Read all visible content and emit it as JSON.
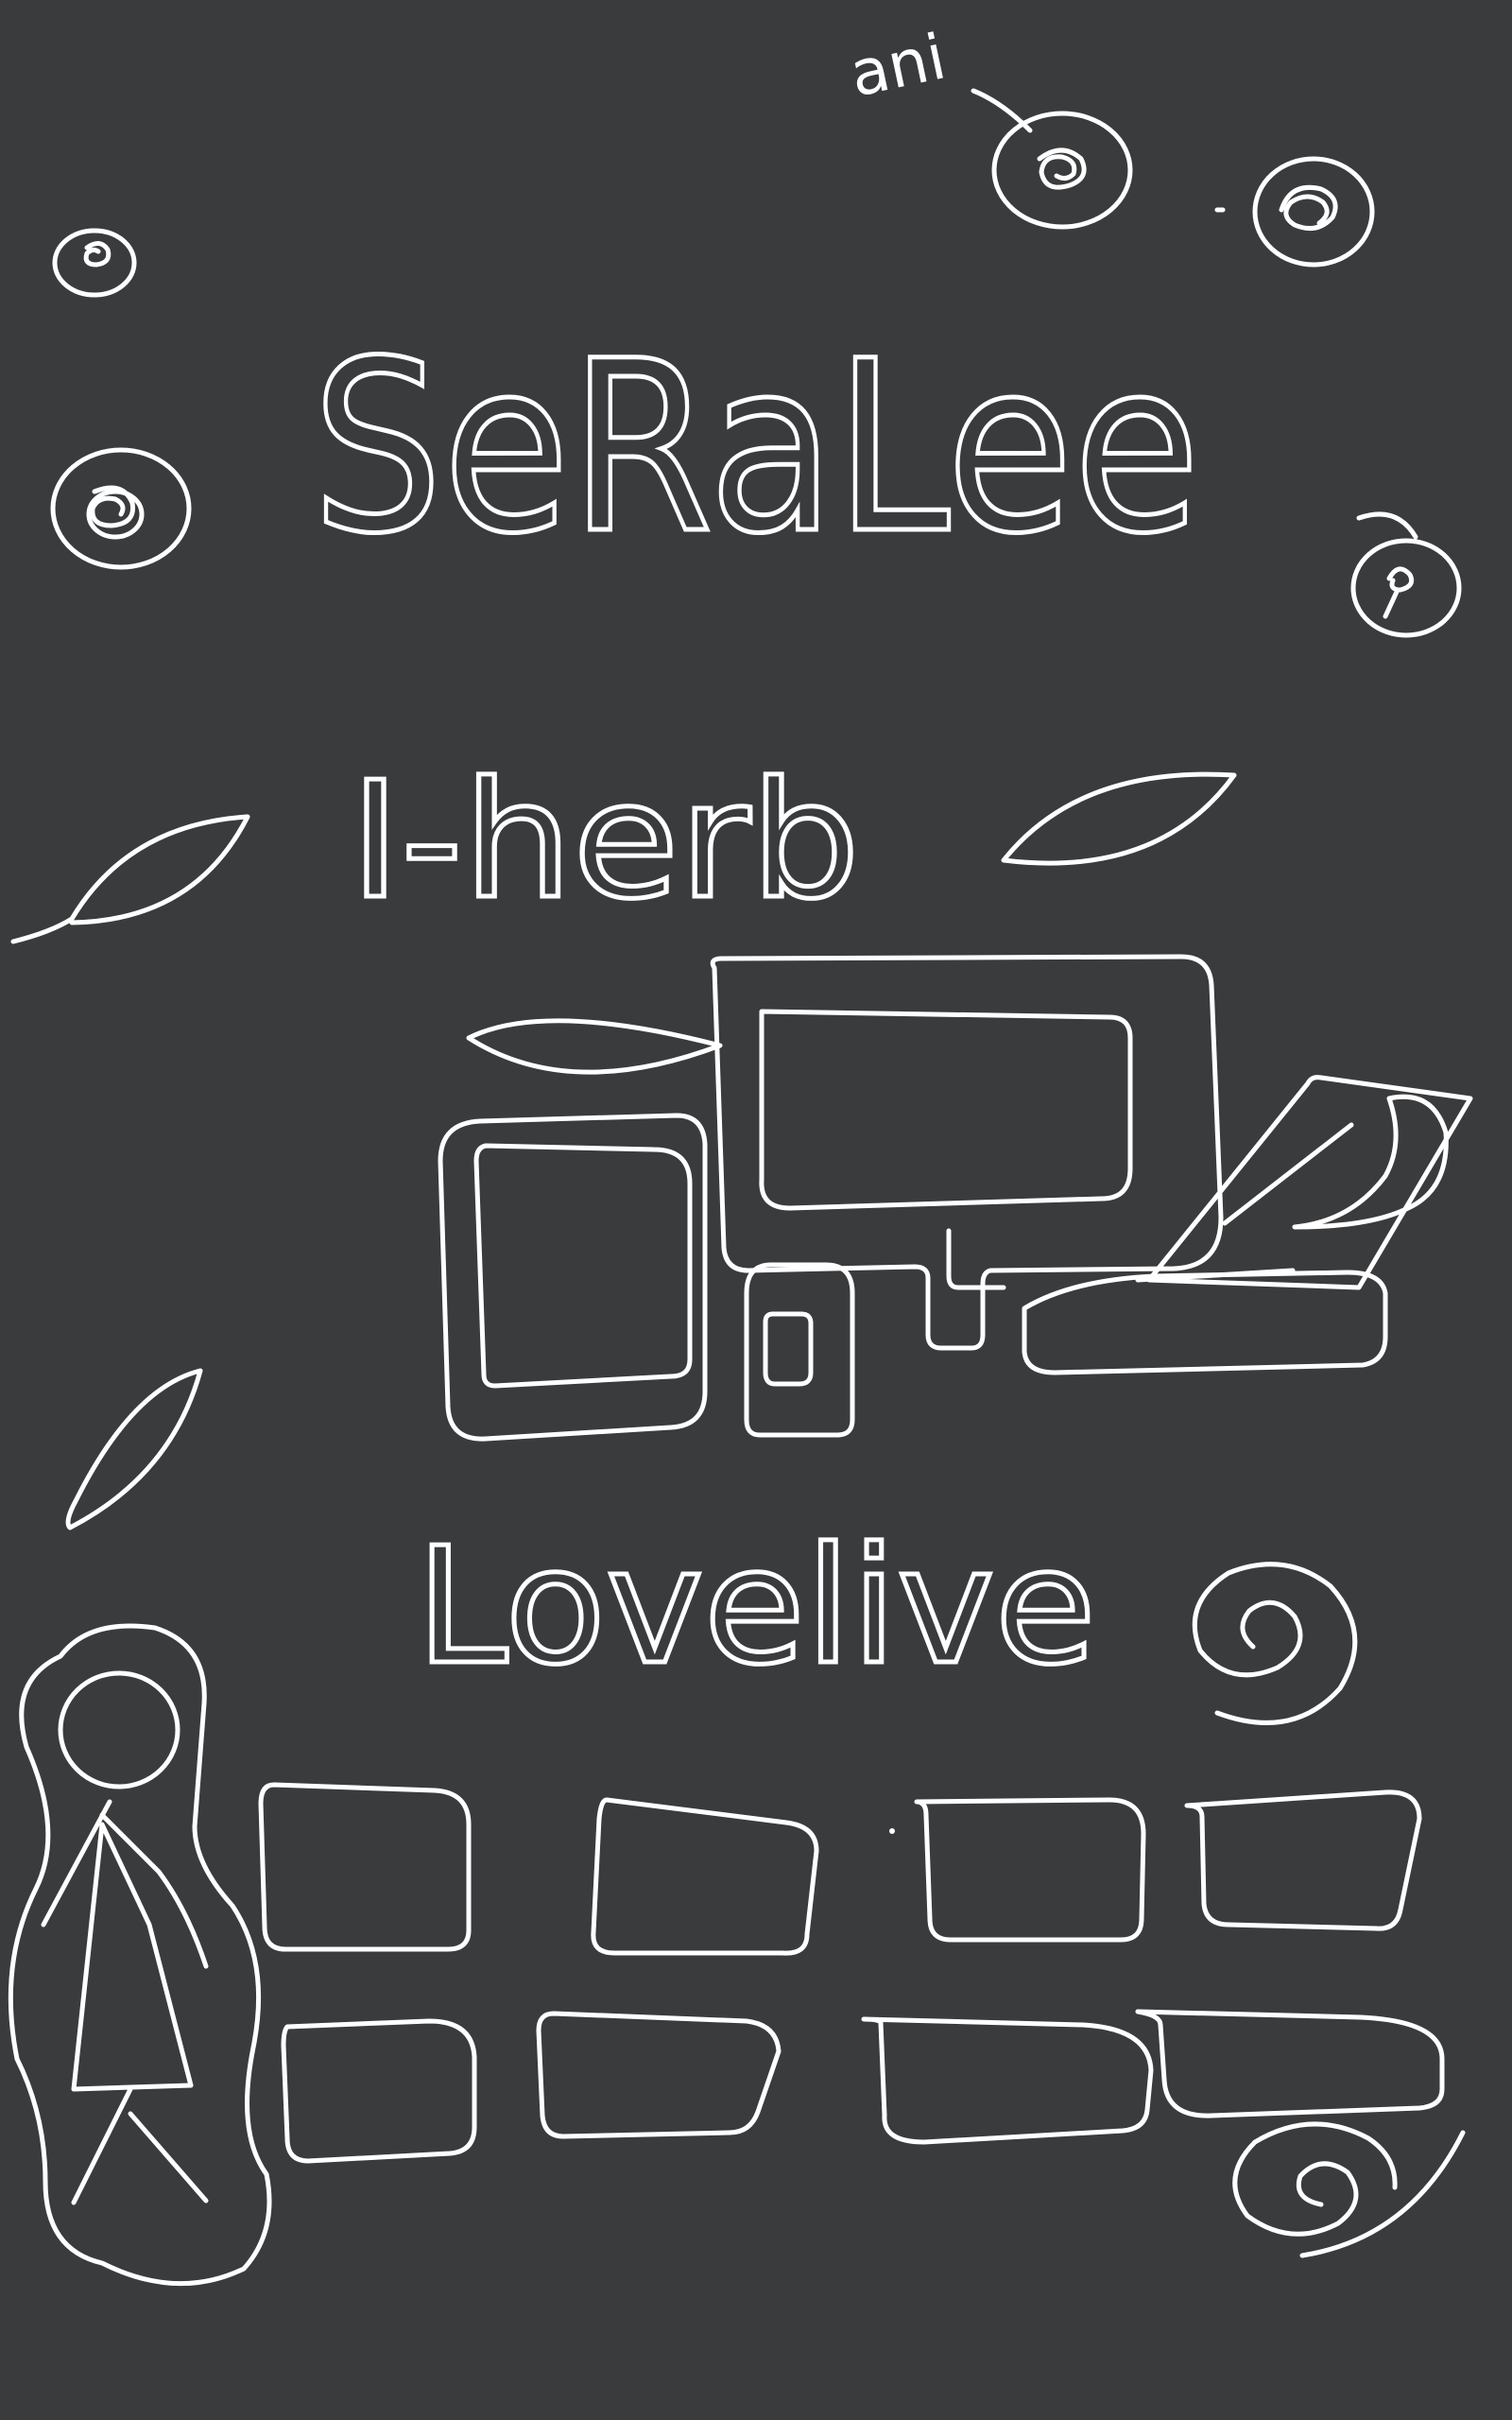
{
  "colors": {
    "background": "#3a3b3d",
    "ink": "#ffffff"
  },
  "texts": {
    "annotation": "ani",
    "title": "SeRaLee",
    "herb_label": "I-herb",
    "lovelive_label": "Lovelive"
  },
  "icons": {
    "circles": "circle-doodle-icon",
    "leaves": "leaf-icon",
    "spirals": "spiral-icon",
    "figure": "person-figure-icon",
    "devices": "computer-setup-icon",
    "cards": "rounded-card-icon"
  }
}
